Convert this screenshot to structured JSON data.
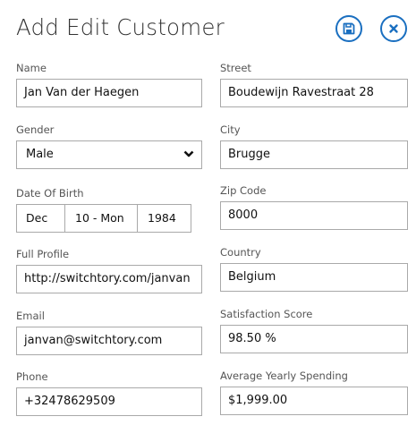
{
  "header": {
    "title": "Add Edit Customer",
    "accent_color": "#1a6fc0",
    "save_icon": "save-icon",
    "close_icon": "close-icon"
  },
  "fields": {
    "name": {
      "label": "Name",
      "value": "Jan Van der Haegen"
    },
    "street": {
      "label": "Street",
      "value": "Boudewijn Ravestraat 28"
    },
    "gender": {
      "label": "Gender",
      "value": "Male"
    },
    "city": {
      "label": "City",
      "value": "Brugge"
    },
    "dob": {
      "label": "Date Of Birth",
      "day": "Dec",
      "month": "10 - Mon",
      "year": "1984"
    },
    "zip": {
      "label": "Zip Code",
      "value": "8000"
    },
    "profile": {
      "label": "Full Profile",
      "value": "http://switchtory.com/janvan"
    },
    "country": {
      "label": "Country",
      "value": "Belgium"
    },
    "email": {
      "label": "Email",
      "value": "janvan@switchtory.com"
    },
    "satisfaction": {
      "label": "Satisfaction Score",
      "value": "98.50 %"
    },
    "phone": {
      "label": "Phone",
      "value": "+32478629509"
    },
    "spending": {
      "label": "Average Yearly Spending",
      "value": "$1,999.00"
    }
  }
}
